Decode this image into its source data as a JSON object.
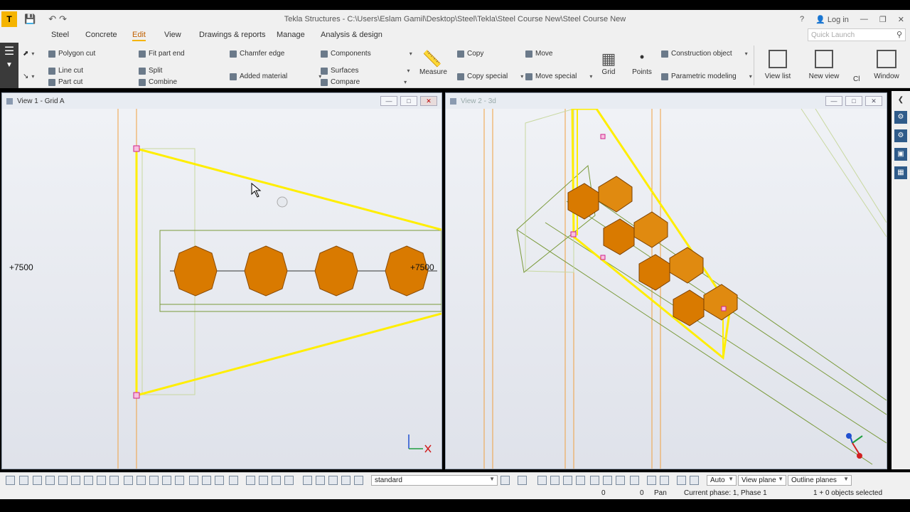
{
  "titlebar": {
    "logo": "T",
    "title": "Tekla Structures - C:\\Users\\Eslam Gamil\\Desktop\\Steel\\Tekla\\Steel Course New\\Steel Course New",
    "help": "?",
    "login": "Log in"
  },
  "menu": {
    "items": [
      "Steel",
      "Concrete",
      "Edit",
      "View",
      "Drawings & reports",
      "Manage",
      "Analysis & design"
    ],
    "active": "Edit",
    "quick_launch_placeholder": "Quick Launch"
  },
  "ribbon": {
    "polygon_cut": "Polygon cut",
    "line_cut": "Line cut",
    "part_cut": "Part cut",
    "fit_part_end": "Fit part end",
    "split": "Split",
    "combine": "Combine",
    "chamfer_edge": "Chamfer edge",
    "added_material": "Added material",
    "components": "Components",
    "surfaces": "Surfaces",
    "compare": "Compare",
    "measure": "Measure",
    "copy": "Copy",
    "copy_special": "Copy special",
    "move": "Move",
    "move_special": "Move special",
    "grid": "Grid",
    "points": "Points",
    "construction_object": "Construction object",
    "parametric_modeling": "Parametric modeling",
    "view_list": "View list",
    "new_view": "New view",
    "cl": "Cl",
    "window": "Window"
  },
  "view1": {
    "title": "View 1 - Grid A",
    "level_left": "+7500",
    "level_right": "+7500"
  },
  "view2": {
    "title": "View 2 - 3d"
  },
  "bottom": {
    "filter_value": "standard",
    "snap_mode": "Auto",
    "plane_mode": "View plane",
    "outline_mode": "Outline planes"
  },
  "status": {
    "x": "0",
    "y": "0",
    "mode": "Pan",
    "phase": "Current phase: 1, Phase 1",
    "selection": "1 + 0 objects selected"
  },
  "colors": {
    "accent": "#f5b400",
    "bolt": "#d97a00",
    "selected_line": "#ffee00",
    "grid_line": "#f0a040",
    "outline": "#7a9a3a"
  }
}
